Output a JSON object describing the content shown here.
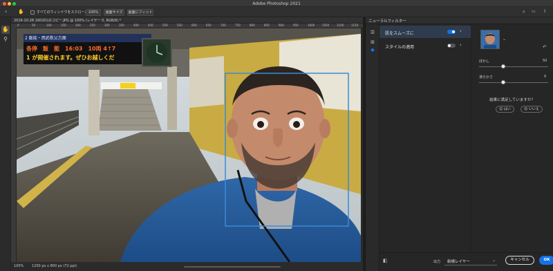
{
  "window": {
    "title": "Adobe Photoshop 2021"
  },
  "options_bar": {
    "scroll_all_label": "すべてのウィンドウをスクロール",
    "zoom_value": "100%",
    "fit_screen_label": "画面サイズ",
    "fill_screen_label": "画面にフィット"
  },
  "document": {
    "tab_title": "2016-10-28 160201のコピー.JPG @ 100% (レイヤー 0, RGB/8) *",
    "zoom": "100%",
    "dimensions": "1200 px x 800 px (72 ppi)"
  },
  "ruler": {
    "ticks": [
      "0",
      "50",
      "100",
      "150",
      "200",
      "250",
      "300",
      "350",
      "400",
      "450",
      "500",
      "550",
      "600",
      "650",
      "700",
      "750",
      "800",
      "850",
      "900",
      "950",
      "1000",
      "1050",
      "1100",
      "1150"
    ]
  },
  "sign": {
    "line1": "2 飯能・西武秩父方面",
    "line2": "各停　飯　能　16:03　10両 4↑7",
    "line3": "1 が開催されます。ぜひお越しくだ"
  },
  "panel": {
    "title": "ニューラルフィルター",
    "filters": [
      {
        "label": "肌をスムーズに",
        "enabled": true
      },
      {
        "label": "スタイルの適用",
        "enabled": false
      }
    ],
    "sliders": [
      {
        "label": "ぼかし",
        "value": "50"
      },
      {
        "label": "滑らかさ",
        "value": "0"
      }
    ],
    "satisfied_question": "結果に満足していますか？",
    "yes_label": "はい",
    "no_label": "いいえ",
    "output_label": "出力",
    "output_value": "新規レイヤー",
    "cancel_label": "キャンセル",
    "ok_label": "OK"
  },
  "colors": {
    "accent": "#1473e6",
    "face_box": "#3b8bd6",
    "toggle_off": "#555555"
  }
}
